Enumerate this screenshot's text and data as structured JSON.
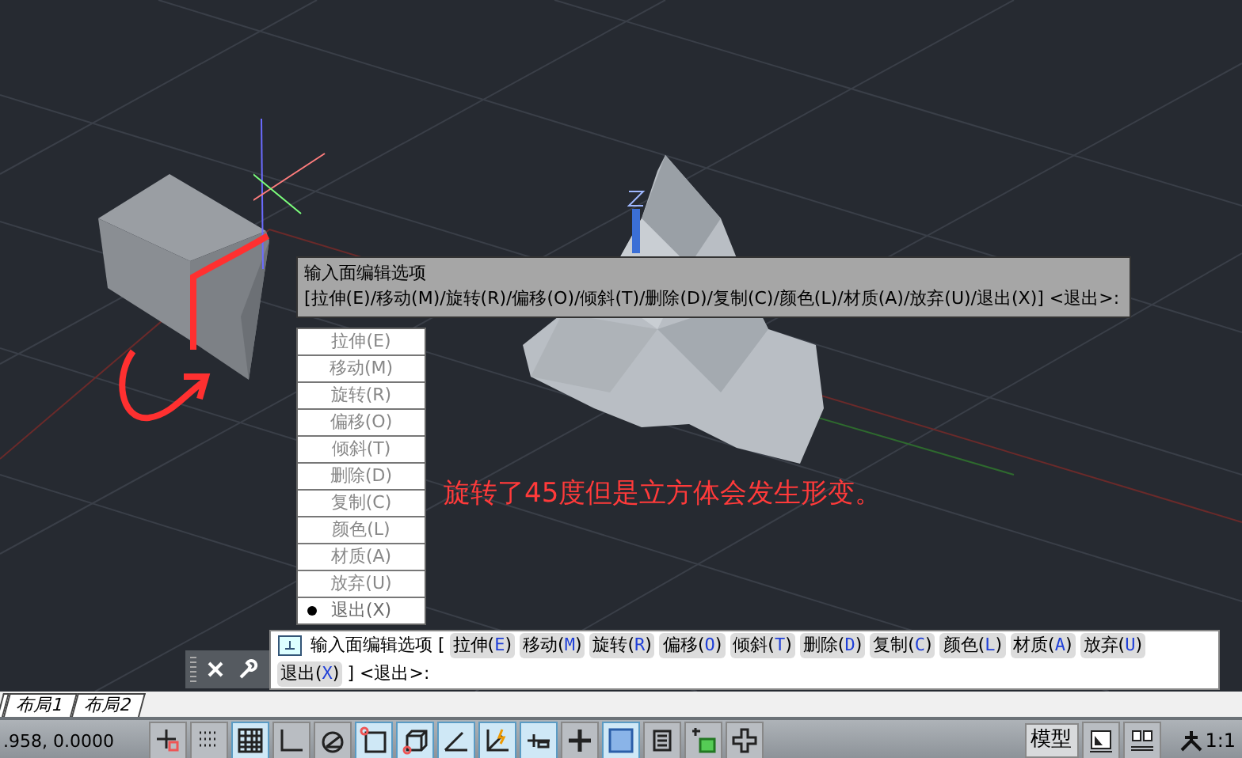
{
  "tooltip": {
    "title": "输入面编辑选项",
    "options": "[拉伸(E)/移动(M)/旋转(R)/偏移(O)/倾斜(T)/删除(D)/复制(C)/颜色(L)/材质(A)/放弃(U)/退出(X)]  <退出>:"
  },
  "menu": [
    {
      "label": "拉伸(E)",
      "selected": false
    },
    {
      "label": "移动(M)",
      "selected": false
    },
    {
      "label": "旋转(R)",
      "selected": false
    },
    {
      "label": "偏移(O)",
      "selected": false
    },
    {
      "label": "倾斜(T)",
      "selected": false
    },
    {
      "label": "删除(D)",
      "selected": false
    },
    {
      "label": "复制(C)",
      "selected": false
    },
    {
      "label": "颜色(L)",
      "selected": false
    },
    {
      "label": "材质(A)",
      "selected": false
    },
    {
      "label": "放弃(U)",
      "selected": false
    },
    {
      "label": "退出(X)",
      "selected": true
    }
  ],
  "annotation": "旋转了45度但是立方体会发生形变。",
  "command_line": {
    "prompt": "输入面编辑选项 [",
    "options": [
      {
        "text": "拉伸(",
        "key": "E",
        "end": ")"
      },
      {
        "text": "移动(",
        "key": "M",
        "end": ")"
      },
      {
        "text": "旋转(",
        "key": "R",
        "end": ")"
      },
      {
        "text": "偏移(",
        "key": "O",
        "end": ")"
      },
      {
        "text": "倾斜(",
        "key": "T",
        "end": ")"
      },
      {
        "text": "删除(",
        "key": "D",
        "end": ")"
      },
      {
        "text": "复制(",
        "key": "C",
        "end": ")"
      },
      {
        "text": "颜色(",
        "key": "L",
        "end": ")"
      },
      {
        "text": "材质(",
        "key": "A",
        "end": ")"
      },
      {
        "text": "放弃(",
        "key": "U",
        "end": ")"
      },
      {
        "text": "退出(",
        "key": "X",
        "end": ")"
      }
    ],
    "suffix": "] <退出>:"
  },
  "layout_tabs": [
    {
      "label": "布局1"
    },
    {
      "label": "布局2"
    }
  ],
  "status_bar": {
    "coordinates": ".958, 0.0000",
    "toggles": [
      {
        "kind": "snap",
        "on": false
      },
      {
        "kind": "dots",
        "on": false
      },
      {
        "kind": "grid",
        "on": true
      },
      {
        "kind": "ortho",
        "on": false
      },
      {
        "kind": "polar",
        "on": false
      },
      {
        "kind": "square",
        "on": true
      },
      {
        "kind": "cube",
        "on": true
      },
      {
        "kind": "angle",
        "on": true
      },
      {
        "kind": "ucs",
        "on": true
      },
      {
        "kind": "dash",
        "on": true
      },
      {
        "kind": "cross",
        "on": false
      },
      {
        "kind": "checker",
        "on": true
      },
      {
        "kind": "list",
        "on": false
      },
      {
        "kind": "layers",
        "on": false
      },
      {
        "kind": "plus",
        "on": false
      }
    ],
    "model": "模型",
    "scale": "1:1"
  }
}
